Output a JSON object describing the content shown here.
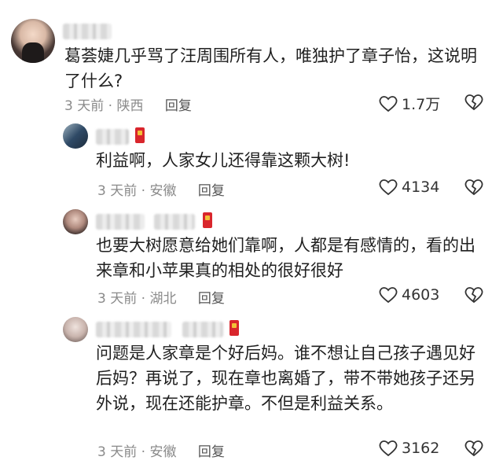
{
  "comments": [
    {
      "text": "葛荟婕几乎骂了汪周围所有人，唯独护了章子怡，这说明了什么?",
      "time": "3 天前",
      "location": "陕西",
      "reply_label": "回复",
      "likes": "1.7万"
    },
    {
      "text": "利益啊，人家女儿还得靠这颗大树!",
      "time": "3 天前",
      "location": "安徽",
      "reply_label": "回复",
      "likes": "4134"
    },
    {
      "text": "也要大树愿意给她们靠啊，人都是有感情的，看的出来章和小苹果真的相处的很好很好",
      "time": "3 天前",
      "location": "湖北",
      "reply_label": "回复",
      "likes": "4603"
    },
    {
      "text": "问题是人家章是个好后妈。谁不想让自己孩子遇见好后妈？再说了，现在章也离婚了，带不带她孩子还另外说，现在还能护章。不但是利益关系。",
      "time": "3 天前",
      "location": "安徽",
      "reply_label": "回复",
      "likes": "3162"
    }
  ],
  "icons": {
    "like": "heart-outline-icon",
    "dislike": "broken-heart-icon"
  }
}
